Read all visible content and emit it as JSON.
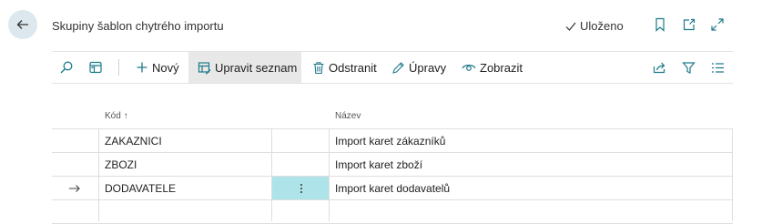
{
  "page": {
    "title": "Skupiny šablon chytrého importu",
    "saved_label": "Uloženo"
  },
  "header_icons": [
    "bookmark-icon",
    "open-new-window-icon",
    "expand-icon"
  ],
  "toolbar": {
    "new_label": "Nový",
    "edit_list_label": "Upravit seznam",
    "delete_label": "Odstranit",
    "edit_label": "Úpravy",
    "view_label": "Zobrazit"
  },
  "table": {
    "columns": {
      "code": "Kód",
      "code_sort": "↑",
      "name": "Název"
    },
    "rows": [
      {
        "code": "ZAKAZNICI",
        "name": "Import karet zákazníků"
      },
      {
        "code": "ZBOZI",
        "name": "Import karet zboží"
      },
      {
        "code": "DODAVATELE",
        "name": "Import karet dodavatelů",
        "selected": true
      },
      {
        "code": "",
        "name": ""
      }
    ]
  },
  "colors": {
    "accent": "#1e7a8c",
    "selection": "#aee3ea",
    "back_button": "#dce8ee"
  }
}
